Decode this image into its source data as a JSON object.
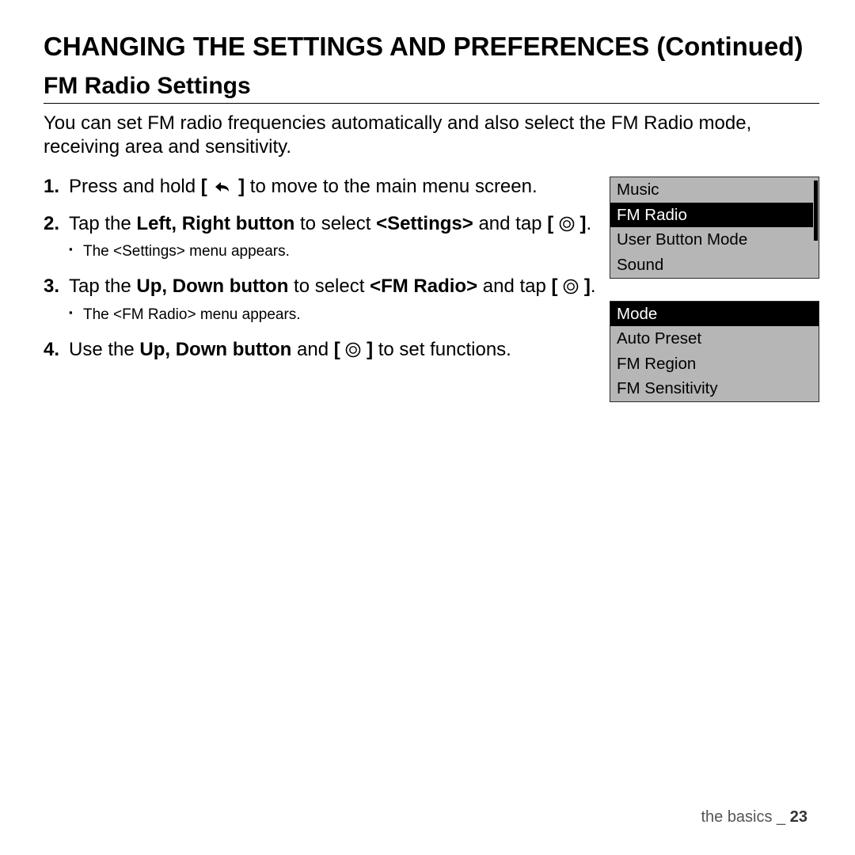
{
  "page_title": "CHANGING THE SETTINGS AND PREFERENCES (Continued)",
  "section_title": "FM Radio Settings",
  "intro": "You can set FM radio frequencies automatically and also select the FM Radio mode, receiving area and sensitivity.",
  "steps": {
    "s1a": "Press and hold ",
    "s1b": " to move to the main menu screen.",
    "s2a": "Tap the ",
    "s2b": "Left, Right button",
    "s2c": " to select ",
    "s2d": "<Settings>",
    "s2e": " and tap ",
    "s2f": ".",
    "s2_sub": "The <Settings> menu appears.",
    "s3a": "Tap the ",
    "s3b": "Up, Down button",
    "s3c": " to select ",
    "s3d": "<FM Radio>",
    "s3e": " and tap ",
    "s3f": ".",
    "s3_sub": "The <FM Radio> menu appears.",
    "s4a": "Use the ",
    "s4b": "Up, Down button",
    "s4c": " and ",
    "s4d": " to set functions."
  },
  "panel1": {
    "r0": "Music",
    "r1": "FM Radio",
    "r2": "User Button Mode",
    "r3": "Sound"
  },
  "panel2": {
    "r0": "Mode",
    "r1": "Auto Preset",
    "r2": "FM Region",
    "r3": "FM Sensitivity"
  },
  "footer_section": "the basics _ ",
  "footer_page": "23"
}
